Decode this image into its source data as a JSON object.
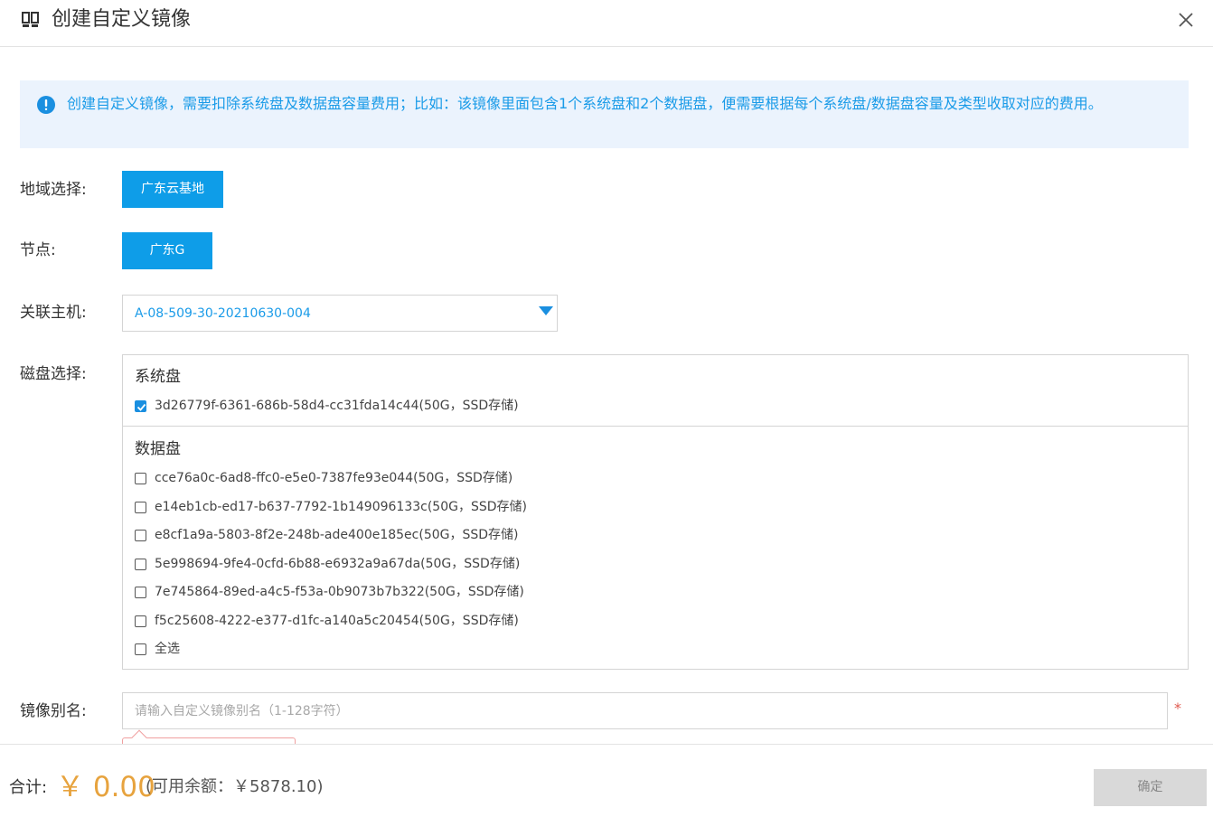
{
  "dialog": {
    "title": "创建自定义镜像",
    "close_icon": "close-icon",
    "logo_icon": "image-stack-icon"
  },
  "notice": {
    "icon": "info-circle-icon",
    "text": "创建自定义镜像，需要扣除系统盘及数据盘容量费用；比如：该镜像里面包含1个系统盘和2个数据盘，便需要根据每个系统盘/数据盘容量及类型收取对应的费用。"
  },
  "region": {
    "label": "地域选择:",
    "selected": "广东云基地"
  },
  "node": {
    "label": "节点:",
    "selected": "广东G"
  },
  "host": {
    "label": "关联主机:",
    "value": "A-08-509-30-20210630-004"
  },
  "disks": {
    "label": "磁盘选择:",
    "system_title": "系统盘",
    "system": [
      {
        "label": "3d26779f-6361-686b-58d4-cc31fda14c44(50G，SSD存储)",
        "checked": true
      }
    ],
    "data_title": "数据盘",
    "data": [
      {
        "label": "cce76a0c-6ad8-ffc0-e5e0-7387fe93e044(50G，SSD存储)",
        "checked": false
      },
      {
        "label": "e14eb1cb-ed17-b637-7792-1b149096133c(50G，SSD存储)",
        "checked": false
      },
      {
        "label": "e8cf1a9a-5803-8f2e-248b-ade400e185ec(50G，SSD存储)",
        "checked": false
      },
      {
        "label": "5e998694-9fe4-0cfd-6b88-e6932a9a67da(50G，SSD存储)",
        "checked": false
      },
      {
        "label": "7e745864-89ed-a4c5-f53a-0b9073b7b322(50G，SSD存储)",
        "checked": false
      },
      {
        "label": "f5c25608-4222-e377-d1fc-a140a5c20454(50G，SSD存储)",
        "checked": false
      }
    ],
    "select_all": "全选"
  },
  "alias": {
    "label": "镜像别名:",
    "placeholder": "请输入自定义镜像别名（1-128字符）",
    "value": "",
    "required_mark": "*"
  },
  "footer": {
    "total_label": "合计:",
    "amount": "￥ 0.00",
    "balance": "(可用余额：￥5878.10)",
    "confirm_label": "确定"
  },
  "colors": {
    "primary": "#0e9de8",
    "notice_bg": "#ebf3fd",
    "amount": "#e7a33e",
    "required": "#e05a4f",
    "disabled_btn": "#d9d9d9"
  }
}
